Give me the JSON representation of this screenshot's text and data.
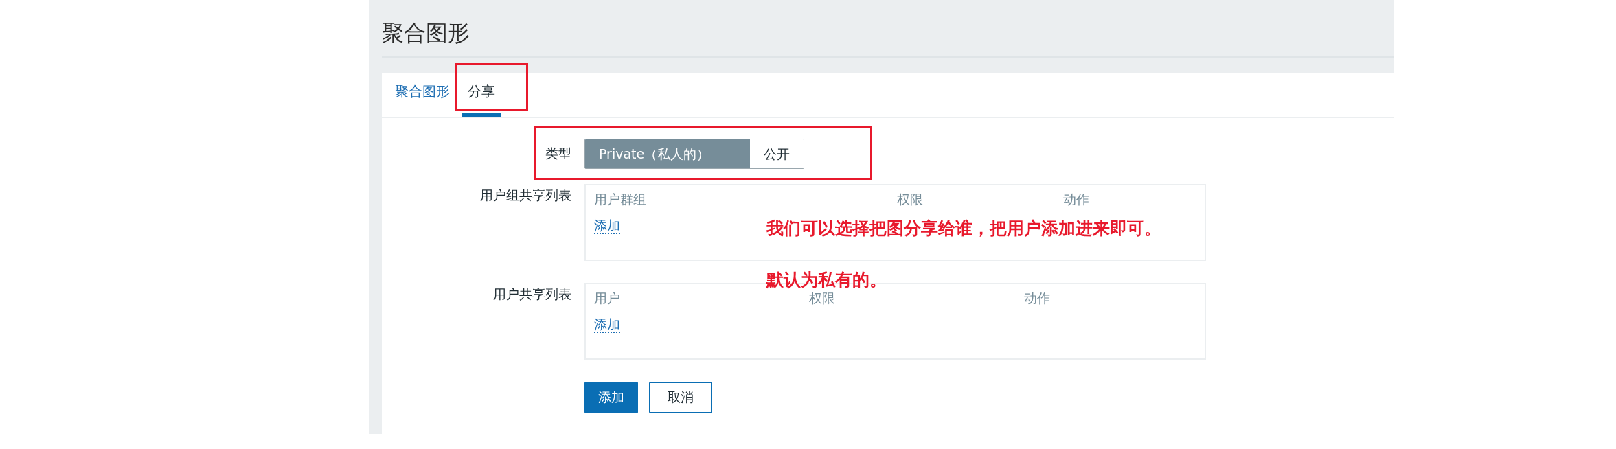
{
  "page_title": "聚合图形",
  "tabs": [
    {
      "label": "聚合图形",
      "selected": false,
      "highlighted": false
    },
    {
      "label": "分享",
      "selected": true,
      "highlighted": true
    }
  ],
  "type_field": {
    "label": "类型",
    "highlighted": true,
    "options": [
      {
        "label": "Private（私人的）",
        "selected": true
      },
      {
        "label": "公开",
        "selected": false
      }
    ]
  },
  "share_lists": [
    {
      "label": "用户组共享列表",
      "columns": [
        "用户群组",
        "权限",
        "动作"
      ],
      "add_link": "添加"
    },
    {
      "label": "用户共享列表",
      "columns": [
        "用户",
        "权限",
        "动作"
      ],
      "add_link": "添加"
    }
  ],
  "buttons": [
    {
      "label": "添加",
      "kind": "primary"
    },
    {
      "label": "取消",
      "kind": "secondary"
    }
  ],
  "annotations": [
    {
      "text": "我们可以选择把图分享给谁，把用户添加进来即可。"
    },
    {
      "text": "默认为私有的。"
    }
  ]
}
